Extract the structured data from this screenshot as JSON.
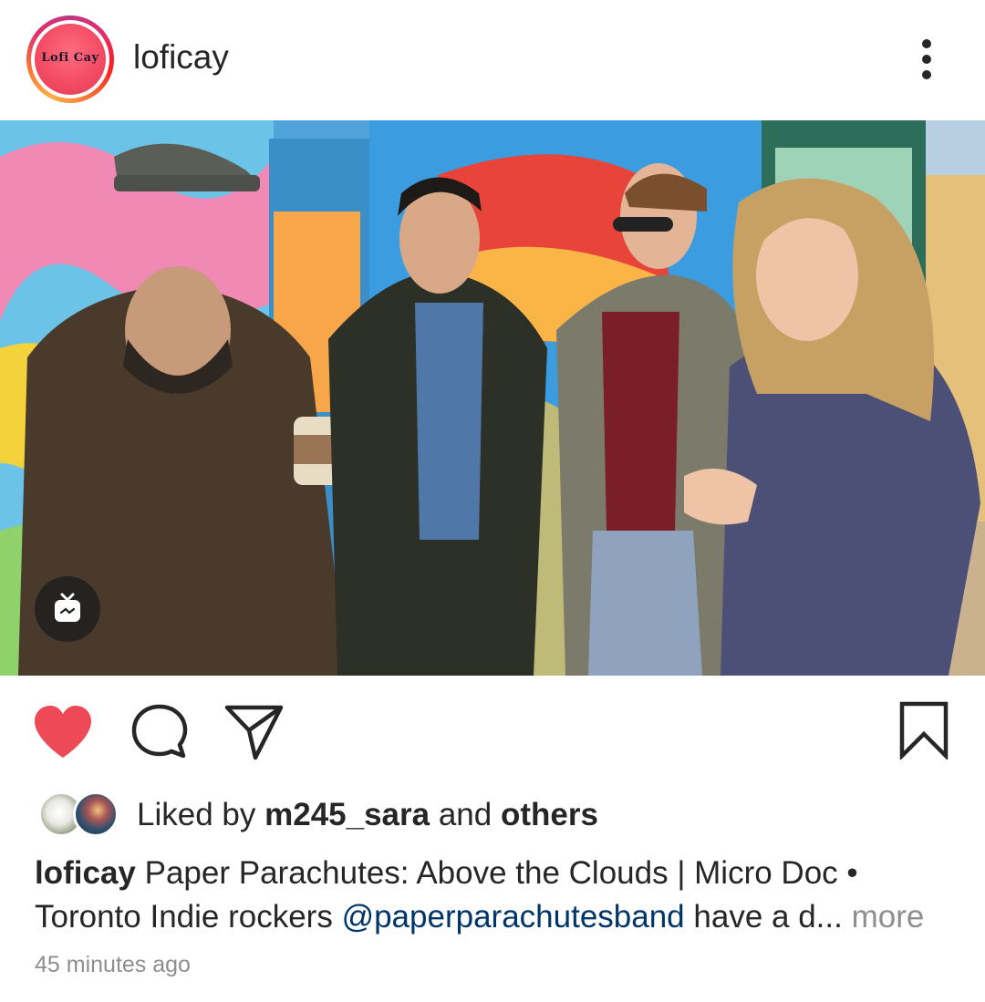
{
  "post": {
    "username": "loficay",
    "avatar_text": "Lofi Cay",
    "photo_alt": "",
    "liked_by_prefix": "Liked by",
    "liked_by_user": "m245_sara",
    "liked_by_and": "and",
    "liked_by_others": "others",
    "caption_user": "loficay",
    "caption_line1": "Paper Parachutes: Above the Clouds | Micro Doc •",
    "caption_line2_pre": "Toronto Indie rockers",
    "caption_mention": "@paperparachutesband",
    "caption_line2_post": "have a d...",
    "more_label": "more",
    "timestamp": "45 minutes ago"
  },
  "icons": {
    "more": "more-vertical-icon",
    "igtv": "igtv-icon",
    "like": "heart-filled-icon",
    "comment": "comment-icon",
    "share": "paper-plane-icon",
    "save": "bookmark-icon"
  },
  "colors": {
    "like_red": "#ed4956",
    "mention_blue": "#003569",
    "muted_gray": "#8e8e8e",
    "text": "#262626"
  }
}
